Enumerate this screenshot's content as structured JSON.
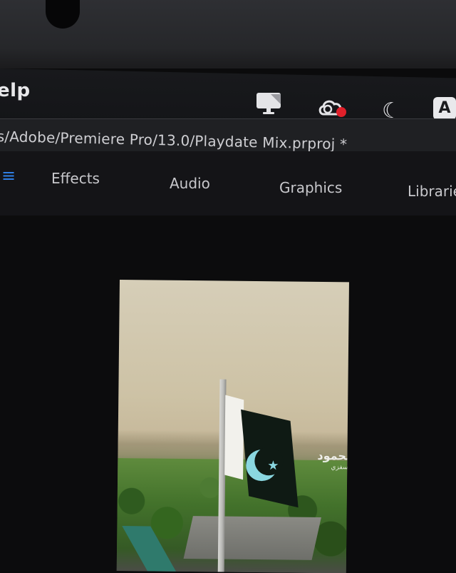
{
  "menubar": {
    "help_label": "Help",
    "help_visible": "elp",
    "input_source": "A",
    "icons": [
      "display-icon",
      "creative-cloud-icon",
      "do-not-disturb-moon-icon",
      "input-source-icon"
    ]
  },
  "titlebar": {
    "path": "s/Adobe/Premiere Pro/13.0/Playdate Mix.prproj *"
  },
  "workspaces": {
    "menu_icon": "hamburger-icon",
    "tabs": [
      {
        "label": "Effects"
      },
      {
        "label": "Audio"
      },
      {
        "label": "Graphics"
      },
      {
        "label": "Librarie"
      }
    ]
  },
  "program_monitor": {
    "watermark_line1": "محمود",
    "watermark_line2": "يوسفزي"
  },
  "colors": {
    "accent": "#2f7fe6",
    "record_dot": "#e0202a"
  }
}
